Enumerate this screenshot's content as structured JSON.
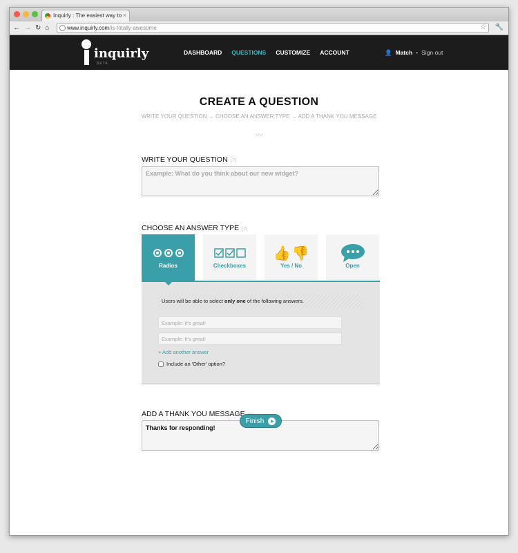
{
  "browser": {
    "tab_title": "Inquirly : The easiest way to",
    "url_domain": "www.inquirly.com",
    "url_path": "/is-totally-awesome"
  },
  "nav": {
    "logo": "inquirly",
    "beta": "BETA",
    "items": [
      "DASHBOARD",
      "QUESTIONS",
      "CUSTOMIZE",
      "ACCOUNT"
    ],
    "active": "QUESTIONS",
    "user": "Match",
    "signout": "Sign out"
  },
  "page": {
    "title": "CREATE A QUESTION",
    "steps": [
      "WRITE YOUR QUESTION",
      "→",
      "CHOOSE AN ANSWER TYPE",
      "→",
      "ADD A THANK YOU MESSAGE"
    ]
  },
  "question": {
    "label": "WRITE YOUR QUESTION",
    "help": "(?)",
    "placeholder": "Example: What do you think about our new widget?",
    "value": ""
  },
  "answer_type": {
    "label": "CHOOSE AN ANSWER TYPE",
    "help": "(?)",
    "types": [
      {
        "label": "Radios",
        "icon": "radio-icon",
        "selected": true
      },
      {
        "label": "Checkboxes",
        "icon": "checkbox-icon",
        "selected": false
      },
      {
        "label": "Yes / No",
        "icon": "thumbs-icon",
        "selected": false
      },
      {
        "label": "Open",
        "icon": "speech-bubble-icon",
        "selected": false
      }
    ],
    "hint_pre": "Users will be able to select ",
    "hint_bold": "only one",
    "hint_post": " of the following answers.",
    "answer_placeholders": [
      "Example: It's great!",
      "Example: It's great!"
    ],
    "add_answer": "+ Add another answer",
    "other_option": "Include an 'Other' option?",
    "other_checked": false
  },
  "thanks": {
    "label": "ADD A THANK YOU MESSAGE",
    "help": "(?)",
    "value": "Thanks for responding!"
  },
  "finish": "Finish",
  "colors": {
    "accent": "#3a9fa8",
    "nav_bg": "#1c1c1c",
    "nav_active": "#3ab8c4"
  }
}
